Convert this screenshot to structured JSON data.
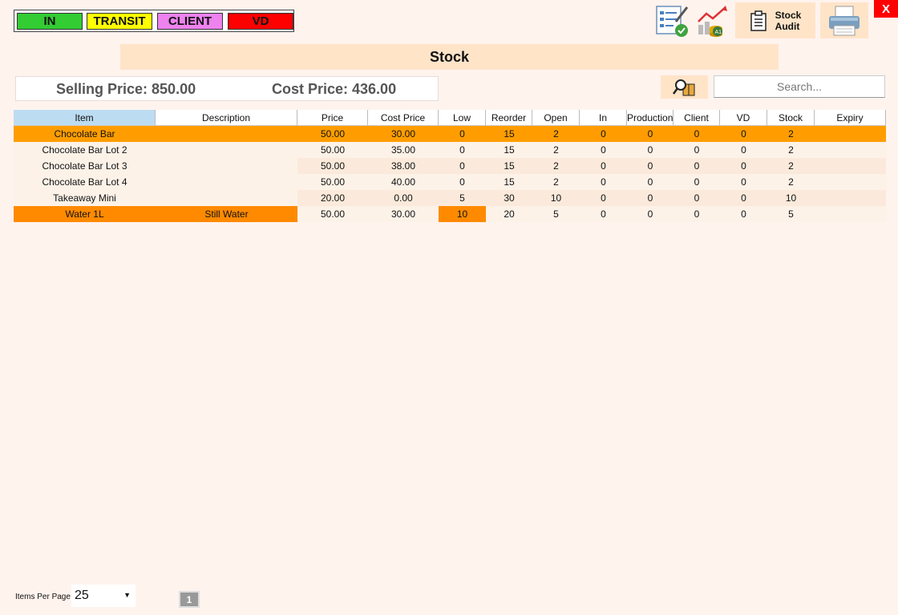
{
  "legend": [
    {
      "label": "IN",
      "color": "#33cc33"
    },
    {
      "label": "TRANSIT",
      "color": "#ffff00"
    },
    {
      "label": "CLIENT",
      "color": "#ee82ee"
    },
    {
      "label": "VD",
      "color": "#ff0000"
    }
  ],
  "toolbar": {
    "audit_label_line1": "Stock",
    "audit_label_line2": "Audit",
    "close_label": "X"
  },
  "page_title": "Stock",
  "summary": {
    "selling_price": "Selling Price: 850.00",
    "cost_price": "Cost Price: 436.00"
  },
  "search": {
    "placeholder": "Search..."
  },
  "table": {
    "columns": [
      "Item",
      "Description",
      "Price",
      "Cost Price",
      "Low",
      "Reorder",
      "Open",
      "In",
      "Production",
      "Client",
      "VD",
      "Stock",
      "Expiry"
    ],
    "rows": [
      [
        "Chocolate Bar",
        "",
        "50.00",
        "30.00",
        "0",
        "15",
        "2",
        "0",
        "0",
        "0",
        "0",
        "2",
        ""
      ],
      [
        "Chocolate Bar Lot 2",
        "",
        "50.00",
        "35.00",
        "0",
        "15",
        "2",
        "0",
        "0",
        "0",
        "0",
        "2",
        ""
      ],
      [
        "Chocolate Bar Lot 3",
        "",
        "50.00",
        "38.00",
        "0",
        "15",
        "2",
        "0",
        "0",
        "0",
        "0",
        "2",
        ""
      ],
      [
        "Chocolate Bar Lot 4",
        "",
        "50.00",
        "40.00",
        "0",
        "15",
        "2",
        "0",
        "0",
        "0",
        "0",
        "2",
        ""
      ],
      [
        "Takeaway Mini",
        "",
        "20.00",
        "0.00",
        "5",
        "30",
        "10",
        "0",
        "0",
        "0",
        "0",
        "10",
        ""
      ],
      [
        "Water 1L",
        "Still Water",
        "50.00",
        "30.00",
        "10",
        "20",
        "5",
        "0",
        "0",
        "0",
        "0",
        "5",
        ""
      ]
    ]
  },
  "footer": {
    "items_per_page_label": "Items Per Page",
    "items_per_page_value": "25",
    "current_page": "1"
  }
}
